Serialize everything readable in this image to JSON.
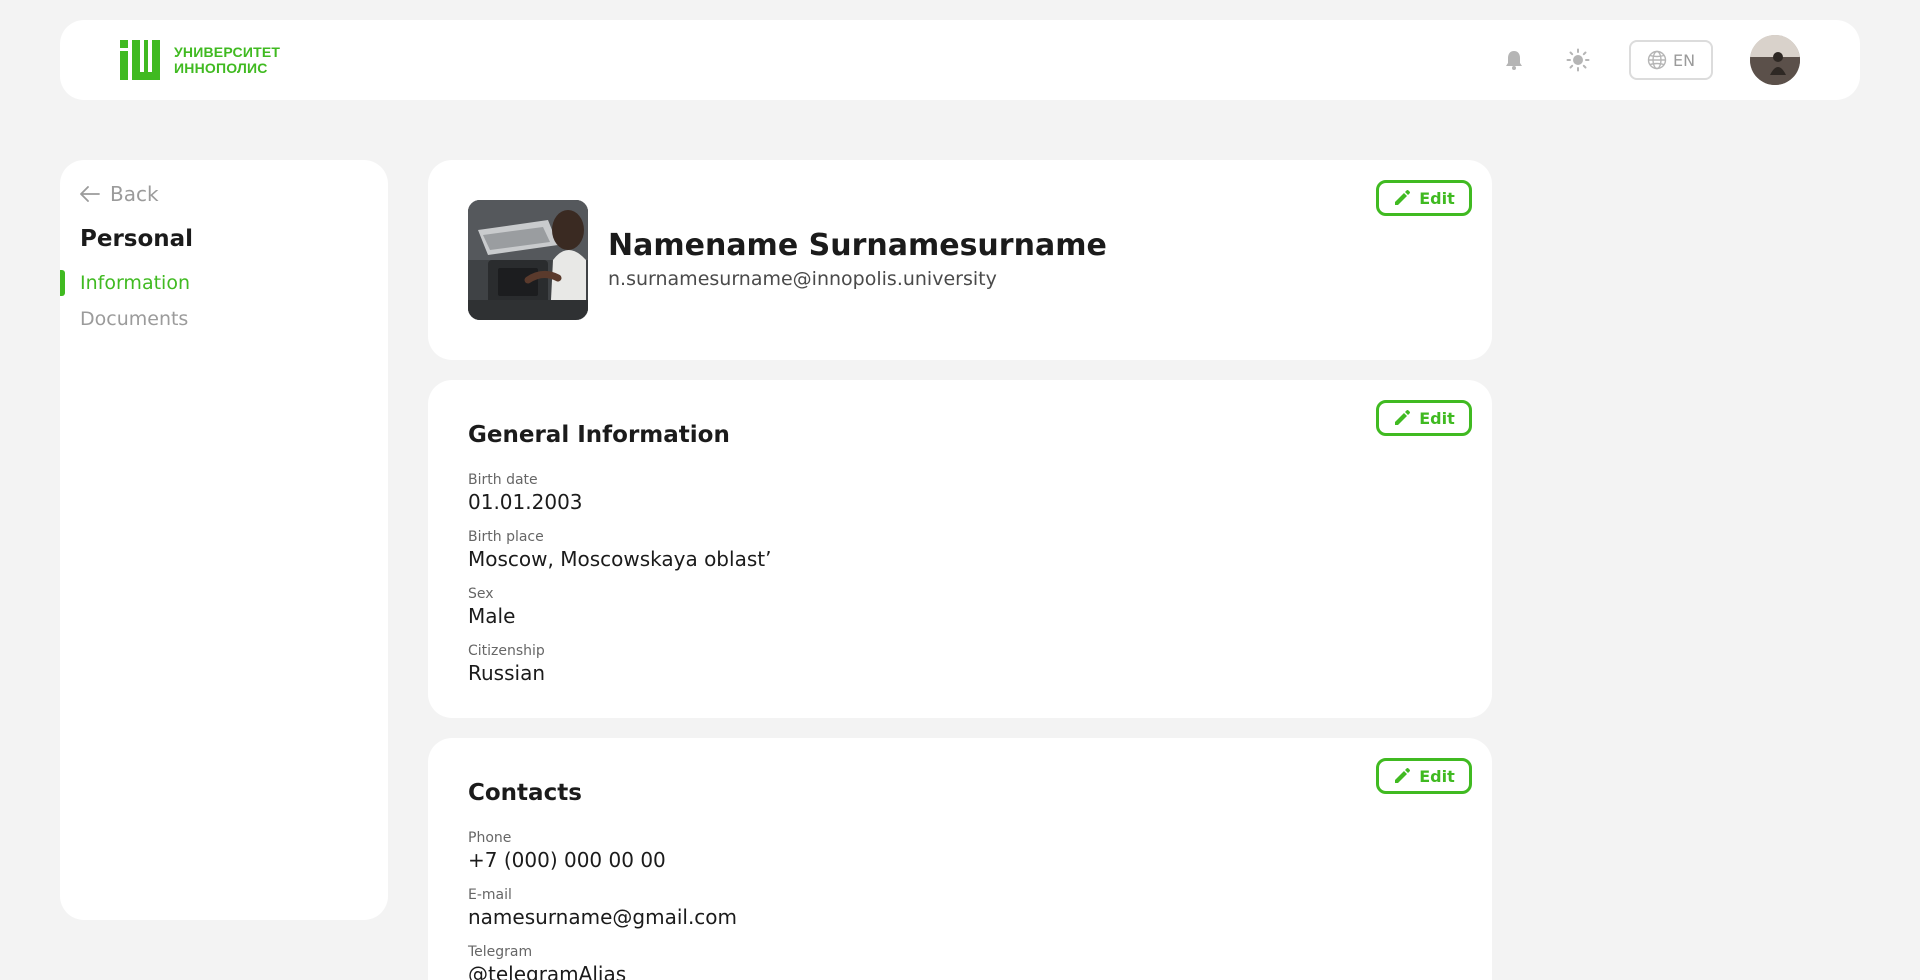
{
  "header": {
    "logo_line1": "УНИВЕРСИТЕТ",
    "logo_line2": "ИННОПОЛИС",
    "language": "EN",
    "icons": [
      "bell-icon",
      "sun-icon",
      "globe-icon"
    ],
    "accent_color": "#40ba21"
  },
  "sidebar": {
    "back_label": "Back",
    "heading": "Personal",
    "items": [
      {
        "label": "Information",
        "active": true
      },
      {
        "label": "Documents",
        "active": false
      }
    ]
  },
  "profile": {
    "name": "Namename Surnamesurname",
    "email": "n.surnamesurname@innopolis.university",
    "edit_label": "Edit"
  },
  "general": {
    "title": "General Information",
    "edit_label": "Edit",
    "fields": [
      {
        "label": "Birth date",
        "value": "01.01.2003"
      },
      {
        "label": "Birth place",
        "value": "Moscow, Moscowskaya oblast’"
      },
      {
        "label": "Sex",
        "value": "Male"
      },
      {
        "label": "Citizenship",
        "value": "Russian"
      }
    ]
  },
  "contacts": {
    "title": "Contacts",
    "edit_label": "Edit",
    "fields": [
      {
        "label": "Phone",
        "value": "+7 (000) 000 00 00"
      },
      {
        "label": "E-mail",
        "value": "namesurname@gmail.com"
      },
      {
        "label": "Telegram",
        "value": "@telegramAlias"
      }
    ]
  }
}
